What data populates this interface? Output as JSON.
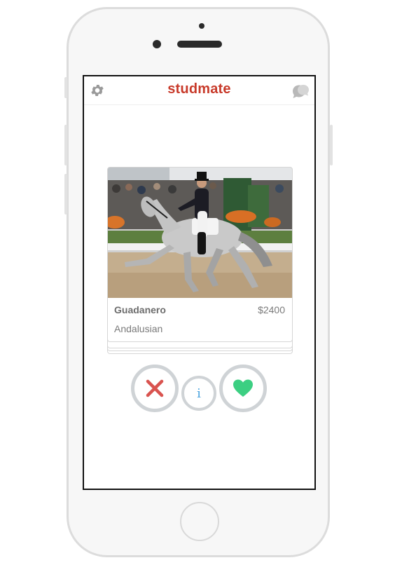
{
  "app": {
    "title": "studmate",
    "brand_color": "#c83a2a"
  },
  "header": {
    "left_icon": "gear-icon",
    "right_icon": "chat-bubbles-icon"
  },
  "card": {
    "name": "Guadanero",
    "price": "$2400",
    "breed": "Andalusian",
    "photo": "dressage-horse-photo"
  },
  "actions": {
    "dislike_icon": "close-x-icon",
    "dislike_color": "#d9534f",
    "info_label": "i",
    "info_color": "#4aa3df",
    "like_icon": "heart-icon",
    "like_color": "#3ccf82"
  }
}
